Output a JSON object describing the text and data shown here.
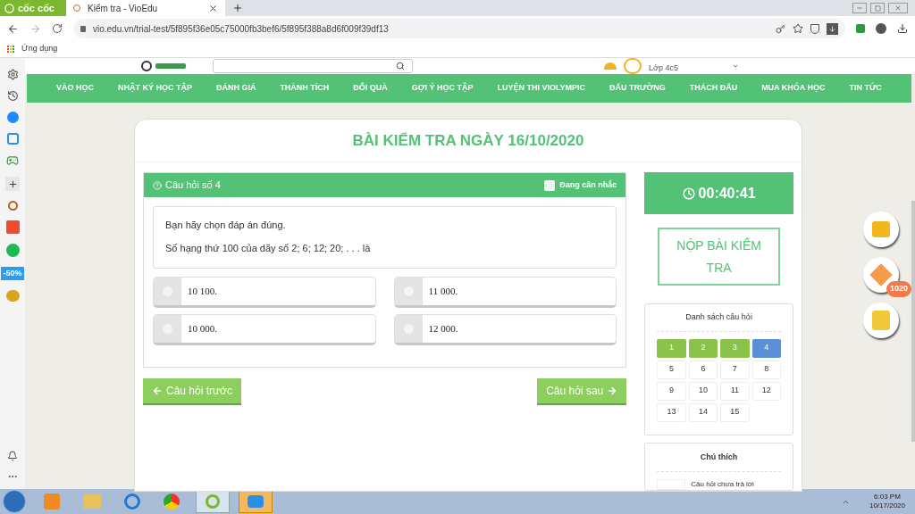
{
  "browser": {
    "brand": "cốc cốc",
    "tab_title": "Kiểm tra - VioEdu",
    "url": "vio.edu.vn/trial-test/5f895f36e05c75000fb3bef6/5f895f388a8d6f009f39df13",
    "bookmarks": [
      "Ứng dụng"
    ],
    "sidebar_badge": "-50%"
  },
  "header": {
    "class_label": "Lớp 4c5"
  },
  "nav": [
    "VÀO HỌC",
    "NHẬT KÝ HỌC TẬP",
    "ĐÁNH GIÁ",
    "THÀNH TÍCH",
    "ĐỔI QUÀ",
    "GỢI Ý HỌC TẬP",
    "LUYỆN THI VIOLYMPIC",
    "ĐẤU TRƯỜNG",
    "THÁCH ĐẤU",
    "MUA KHÓA HỌC",
    "TIN TỨC"
  ],
  "test": {
    "title": "BÀI KIỂM TRA NGÀY 16/10/2020",
    "question": {
      "label": "Câu hỏi số 4",
      "flag": {
        "label": "Đang cân nhắc",
        "checked": false
      },
      "instruction": "Bạn hãy chọn đáp án đúng.",
      "text": "Số hạng thứ 100 của dãy số 2; 6; 12; 20; . . . là",
      "options": [
        {
          "text": "10 100.",
          "selected": false
        },
        {
          "text": "11 000.",
          "selected": false
        },
        {
          "text": "10 000.",
          "selected": false
        },
        {
          "text": "12 000.",
          "selected": false
        }
      ]
    },
    "prev_button": "Câu hỏi trước",
    "next_button": "Câu hỏi sau",
    "timer": "00:40:41",
    "submit_button": "NỘP BÀI KIỂM TRA",
    "question_list": {
      "title": "Danh sách câu hỏi",
      "items": [
        {
          "number": "1",
          "answered": true,
          "selected": false
        },
        {
          "number": "2",
          "answered": true,
          "selected": false
        },
        {
          "number": "3",
          "answered": true,
          "selected": false
        },
        {
          "number": "4",
          "answered": false,
          "selected": true
        },
        {
          "number": "5",
          "answered": false,
          "selected": false
        },
        {
          "number": "6",
          "answered": false,
          "selected": false
        },
        {
          "number": "7",
          "answered": false,
          "selected": false
        },
        {
          "number": "8",
          "answered": false,
          "selected": false
        },
        {
          "number": "9",
          "answered": false,
          "selected": false
        },
        {
          "number": "10",
          "answered": false,
          "selected": false
        },
        {
          "number": "11",
          "answered": false,
          "selected": false
        },
        {
          "number": "12",
          "answered": false,
          "selected": false
        },
        {
          "number": "13",
          "answered": false,
          "selected": false
        },
        {
          "number": "14",
          "answered": false,
          "selected": false
        },
        {
          "number": "15",
          "answered": false,
          "selected": false
        }
      ]
    },
    "legend": {
      "title": "Chú thích",
      "items": [
        "Câu hỏi chưa trả lời"
      ]
    }
  },
  "floating": {
    "gem_count": "1020"
  },
  "taskbar": {
    "time": "6:03 PM",
    "date": "10/17/2020"
  }
}
